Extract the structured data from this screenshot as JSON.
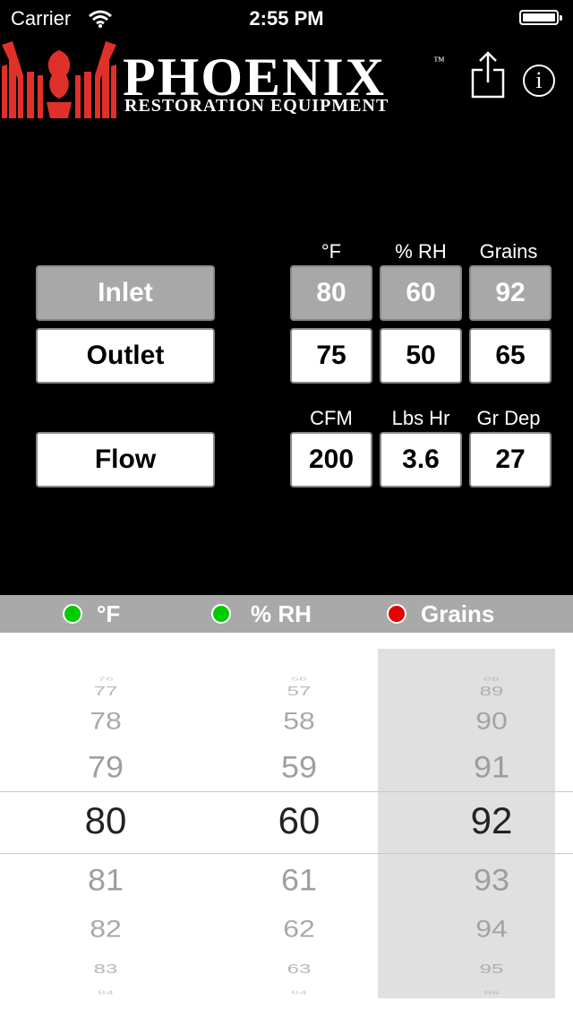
{
  "status_bar": {
    "carrier": "Carrier",
    "time": "2:55 PM"
  },
  "header": {
    "brand": "PHOENIX",
    "trademark": "™",
    "tagline": "RESTORATION EQUIPMENT",
    "logo_icon": "phoenix-logo-icon",
    "share_icon": "share-icon",
    "info_icon": "info-icon",
    "info_glyph": "i"
  },
  "readings": {
    "top_headers": [
      "°F",
      "% RH",
      "Grains"
    ],
    "inlet": {
      "label": "Inlet",
      "values": [
        "80",
        "60",
        "92"
      ]
    },
    "outlet": {
      "label": "Outlet",
      "values": [
        "75",
        "50",
        "65"
      ]
    },
    "flow_headers": [
      "CFM",
      "Lbs Hr",
      "Gr Dep"
    ],
    "flow": {
      "label": "Flow",
      "values": [
        "200",
        "3.6",
        "27"
      ]
    }
  },
  "picker_header": [
    {
      "label": "°F",
      "status_color": "#00cc00"
    },
    {
      "label": "% RH",
      "status_color": "#00cc00"
    },
    {
      "label": "Grains",
      "status_color": "#e60000"
    }
  ],
  "picker": {
    "columns": [
      {
        "values": [
          "76",
          "77",
          "78",
          "79",
          "80",
          "81",
          "82",
          "83",
          "84"
        ],
        "selected": "80"
      },
      {
        "values": [
          "56",
          "57",
          "58",
          "59",
          "60",
          "61",
          "62",
          "63",
          "64"
        ],
        "selected": "60"
      },
      {
        "values": [
          "88",
          "89",
          "90",
          "91",
          "92",
          "93",
          "94",
          "95",
          "96"
        ],
        "selected": "92"
      }
    ]
  },
  "colors": {
    "selected_button": "#a8a8a8",
    "background": "#000000",
    "logo_red": "#e0302a"
  }
}
